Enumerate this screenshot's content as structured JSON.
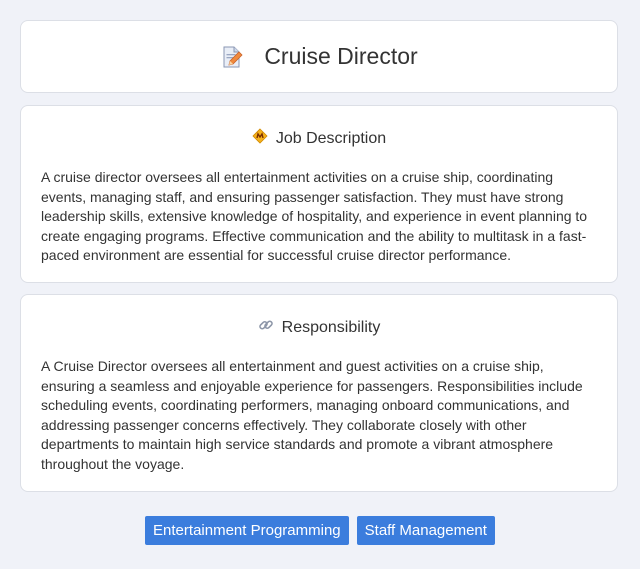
{
  "header": {
    "title": "Cruise Director",
    "icon": "document-pencil-icon"
  },
  "job_description": {
    "heading": "Job Description",
    "icon": "badge-icon",
    "text": "A cruise director oversees all entertainment activities on a cruise ship, coordinating events, managing staff, and ensuring passenger satisfaction. They must have strong leadership skills, extensive knowledge of hospitality, and experience in event planning to create engaging programs. Effective communication and the ability to multitask in a fast-paced environment are essential for successful cruise director performance."
  },
  "responsibility": {
    "heading": "Responsibility",
    "icon": "link-icon",
    "text": "A Cruise Director oversees all entertainment and guest activities on a cruise ship, ensuring a seamless and enjoyable experience for passengers. Responsibilities include scheduling events, coordinating performers, managing onboard communications, and addressing passenger concerns effectively. They collaborate closely with other departments to maintain high service standards and promote a vibrant atmosphere throughout the voyage."
  },
  "tags": [
    "Entertainment Programming",
    "Staff Management"
  ],
  "colors": {
    "background": "#f0f2f8",
    "tag": "#3b7ddd"
  }
}
